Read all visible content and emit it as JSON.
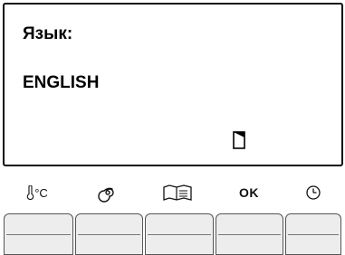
{
  "display": {
    "title": "Язык:",
    "value": "ENGLISH",
    "scroll_indicator_icon": "scroll-position-icon"
  },
  "softkeys": [
    {
      "icon": "thermometer-celsius-icon",
      "label": "°C"
    },
    {
      "icon": "heating-spiral-icon"
    },
    {
      "icon": "book-menu-icon"
    },
    {
      "label": "OK"
    },
    {
      "icon": "clock-icon"
    }
  ],
  "colors": {
    "frame": "#111111",
    "button_fill": "#ededed",
    "button_border": "#555555"
  }
}
